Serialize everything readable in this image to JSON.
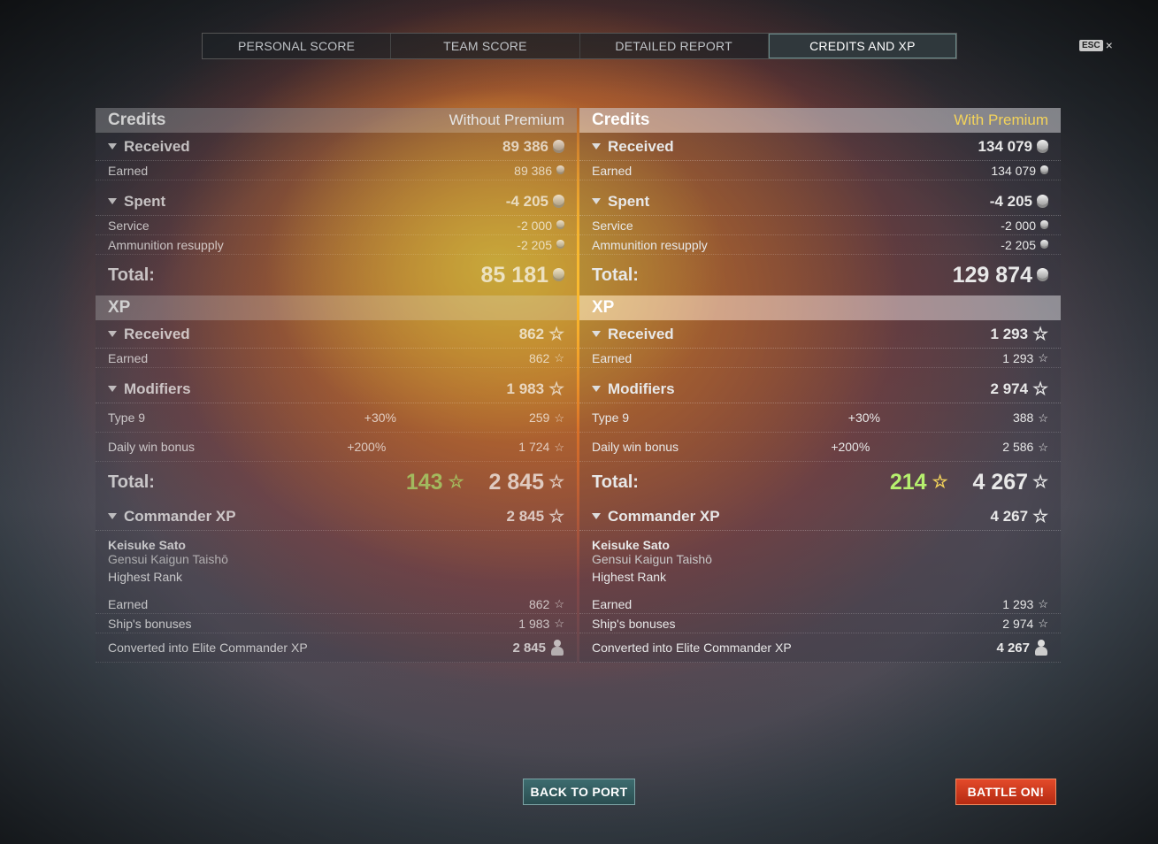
{
  "tabs": [
    "PERSONAL SCORE",
    "TEAM SCORE",
    "DETAILED REPORT",
    "CREDITS AND XP"
  ],
  "esc": {
    "key": "ESC",
    "close": "×"
  },
  "colors": {
    "accent_premium": "#f3d35a",
    "bonus_green": "#9dd36a",
    "battle_button": "#d03a1c",
    "port_button": "#2f5a5d"
  },
  "left": {
    "credits_title": "Credits",
    "credits_sub": "Without Premium",
    "received": "Received",
    "received_val": "89 386",
    "earned": "Earned",
    "earned_val": "89 386",
    "spent": "Spent",
    "spent_val": "-4 205",
    "service": "Service",
    "service_val": "-2 000",
    "ammo": "Ammunition resupply",
    "ammo_val": "-2 205",
    "credits_total_label": "Total:",
    "credits_total": "85 181",
    "xp_title": "XP",
    "xp_received": "Received",
    "xp_received_val": "862",
    "xp_earned": "Earned",
    "xp_earned_val": "862",
    "modifiers": "Modifiers",
    "modifiers_val": "1 983",
    "type9": "Type 9",
    "type9_pct": "+30%",
    "type9_val": "259",
    "daily": "Daily win bonus",
    "daily_pct": "+200%",
    "daily_val": "1 724",
    "xp_total_label": "Total:",
    "xp_bonus": "143",
    "xp_total": "2 845",
    "cmd_title": "Commander XP",
    "cmd_val": "2 845",
    "cmd_name": "Keisuke Sato",
    "cmd_rank": "Gensui Kaigun Taishō",
    "cmd_highest": "Highest Rank",
    "cmd_earned": "Earned",
    "cmd_earned_val": "862",
    "cmd_ship": "Ship's bonuses",
    "cmd_ship_val": "1 983",
    "cmd_conv": "Converted into Elite Commander XP",
    "cmd_conv_val": "2 845"
  },
  "right": {
    "credits_title": "Credits",
    "credits_sub": "With Premium",
    "received": "Received",
    "received_val": "134 079",
    "earned": "Earned",
    "earned_val": "134 079",
    "spent": "Spent",
    "spent_val": "-4 205",
    "service": "Service",
    "service_val": "-2 000",
    "ammo": "Ammunition resupply",
    "ammo_val": "-2 205",
    "credits_total_label": "Total:",
    "credits_total": "129 874",
    "xp_title": "XP",
    "xp_received": "Received",
    "xp_received_val": "1 293",
    "xp_earned": "Earned",
    "xp_earned_val": "1 293",
    "modifiers": "Modifiers",
    "modifiers_val": "2 974",
    "type9": "Type 9",
    "type9_pct": "+30%",
    "type9_val": "388",
    "daily": "Daily win bonus",
    "daily_pct": "+200%",
    "daily_val": "2 586",
    "xp_total_label": "Total:",
    "xp_bonus": "214",
    "xp_total": "4 267",
    "cmd_title": "Commander XP",
    "cmd_val": "4 267",
    "cmd_name": "Keisuke Sato",
    "cmd_rank": "Gensui Kaigun Taishō",
    "cmd_highest": "Highest Rank",
    "cmd_earned": "Earned",
    "cmd_earned_val": "1 293",
    "cmd_ship": "Ship's bonuses",
    "cmd_ship_val": "2 974",
    "cmd_conv": "Converted into Elite Commander XP",
    "cmd_conv_val": "4 267"
  },
  "buttons": {
    "back": "BACK TO PORT",
    "battle": "BATTLE ON!"
  }
}
